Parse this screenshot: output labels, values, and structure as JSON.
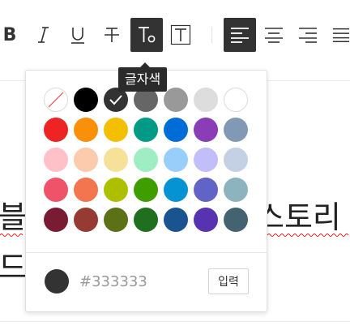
{
  "toolbar": {
    "buttons": [
      {
        "id": "bold",
        "icon": "bold-icon"
      },
      {
        "id": "italic",
        "icon": "italic-icon"
      },
      {
        "id": "underline",
        "icon": "underline-icon"
      },
      {
        "id": "strikethrough",
        "icon": "strikethrough-icon"
      },
      {
        "id": "text-color",
        "icon": "text-color-icon",
        "active": true
      },
      {
        "id": "background-color",
        "icon": "text-background-icon"
      },
      {
        "id": "align-left",
        "icon": "align-left-icon",
        "active": true
      },
      {
        "id": "align-center",
        "icon": "align-center-icon"
      },
      {
        "id": "align-right",
        "icon": "align-right-icon"
      },
      {
        "id": "align-justify",
        "icon": "align-justify-icon"
      }
    ],
    "bold_glyph": "B"
  },
  "tooltip": {
    "text": "글자색"
  },
  "document": {
    "line1_left": "블",
    "line1_right": "스토리",
    "line2_left": "드"
  },
  "color_picker": {
    "selected": "#333333",
    "rows": [
      [
        "none",
        "#000000",
        "#333333",
        "#666666",
        "#999999",
        "#dddddd",
        "#ffffff"
      ],
      [
        "#ee2323",
        "#f89009",
        "#f3c000",
        "#009a87",
        "#006dd7",
        "#8a3db6",
        "#781b33"
      ],
      [
        "#ffc1c8",
        "#fccaad",
        "#f6e199",
        "#9feec3",
        "#99cefa",
        "#c1bef9",
        "#c4d0e4"
      ],
      [
        "#ef5369",
        "#f3754f",
        "#aebf00",
        "#409d00",
        "#0593d3",
        "#6164c6",
        "#8cb3be"
      ],
      [
        "#781b33",
        "#953b34",
        "#5c7016",
        "#1f6f1f",
        "#1a5490",
        "#5733b1",
        "#42636f"
      ]
    ],
    "row2_last": "#8299b5",
    "hex_placeholder": "#333333",
    "apply_label": "입력"
  }
}
